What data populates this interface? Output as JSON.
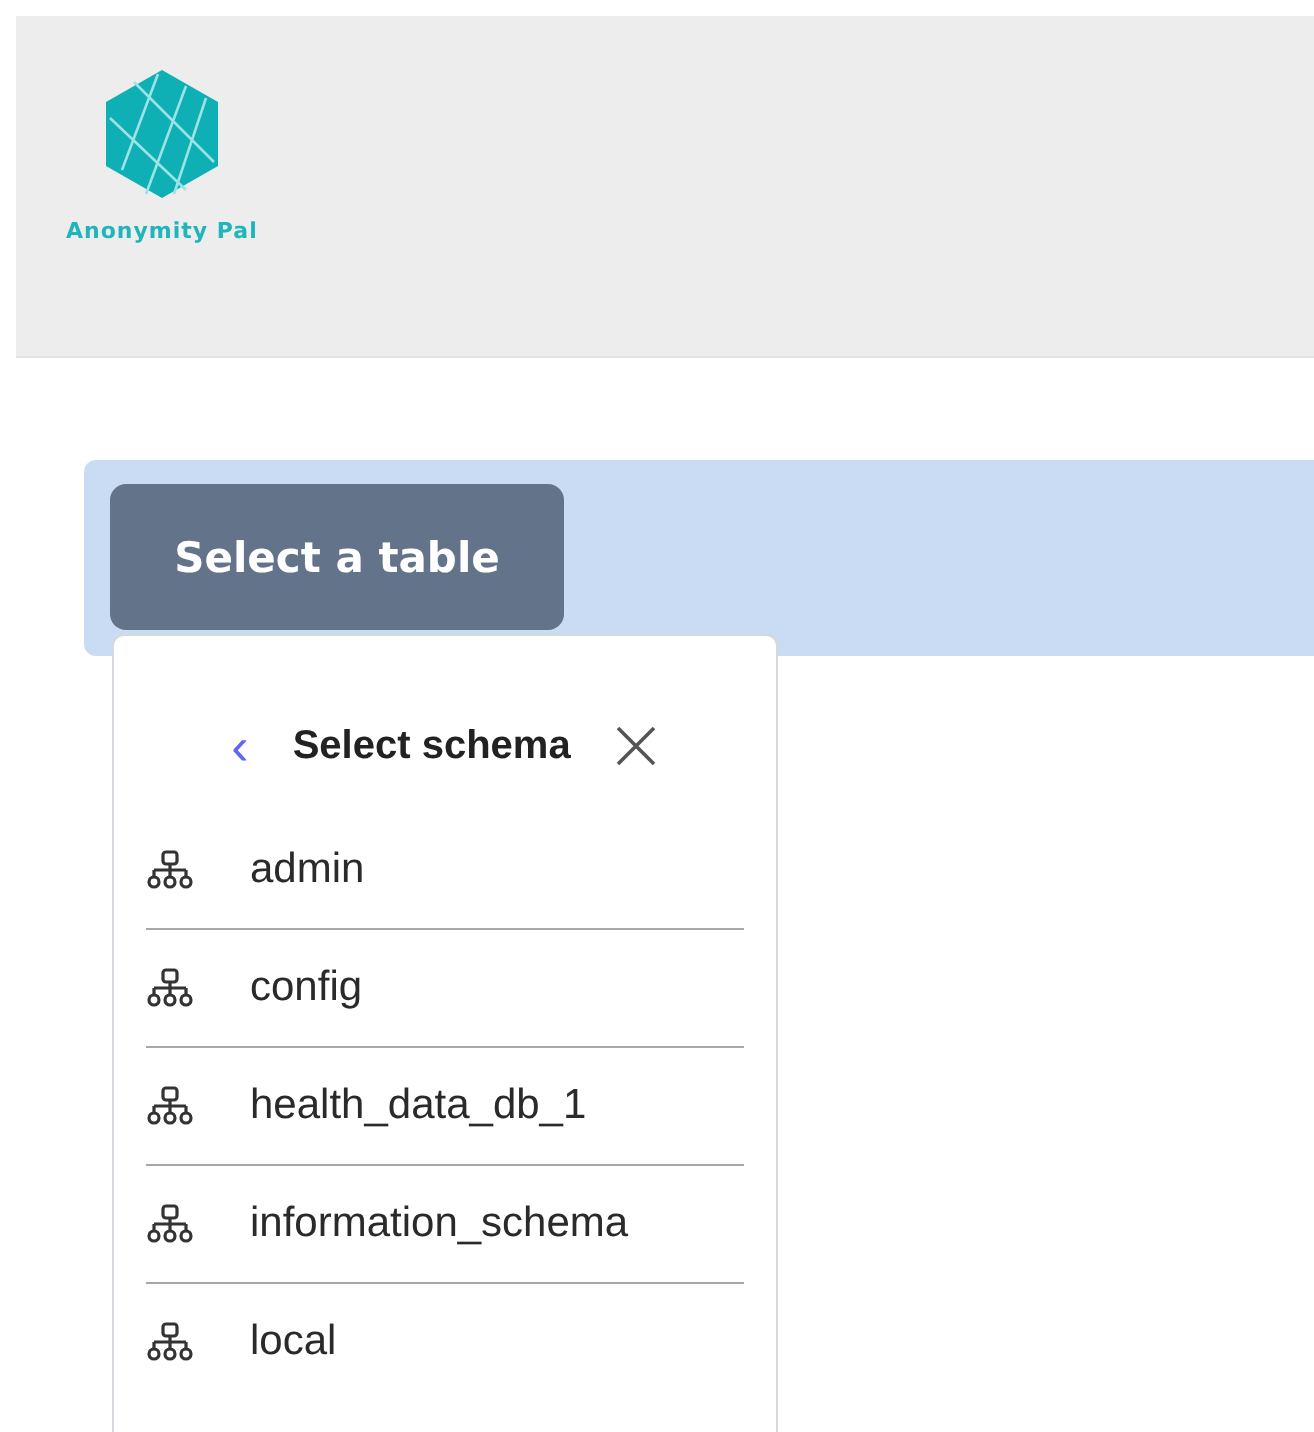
{
  "header": {
    "logo_text": "Anonymity Pal"
  },
  "toolbar": {
    "button": "Select a table"
  },
  "dropdown": {
    "title": "Select schema",
    "back": "‹",
    "items": [
      {
        "label": "admin"
      },
      {
        "label": "config"
      },
      {
        "label": "health_data_db_1"
      },
      {
        "label": "information_schema"
      },
      {
        "label": "local"
      }
    ]
  }
}
